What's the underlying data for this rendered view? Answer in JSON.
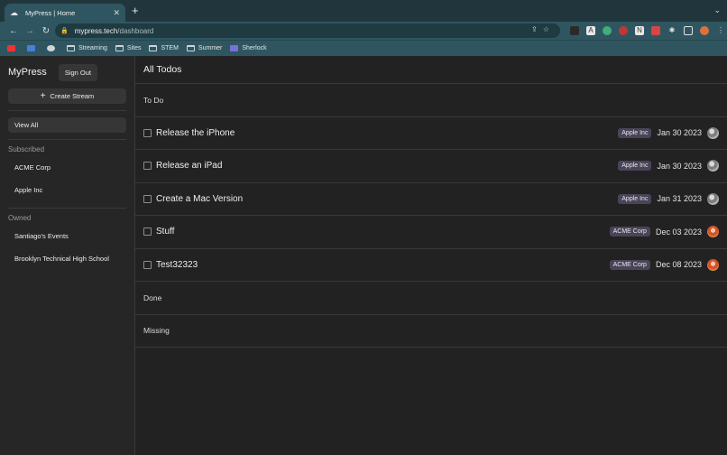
{
  "browser": {
    "tab_title": "MyPress | Home",
    "tab_close": "✕",
    "new_tab": "+",
    "url_host": "mypress.tech",
    "url_path": "/dashboard",
    "bookmarks": [
      {
        "label": "Streaming",
        "icon": "folder-icon"
      },
      {
        "label": "Sites",
        "icon": "folder-icon"
      },
      {
        "label": "STEM",
        "icon": "folder-icon"
      },
      {
        "label": "Summer",
        "icon": "folder-icon"
      },
      {
        "label": "Sherlock",
        "icon": "sherlock-bookmark-icon"
      }
    ]
  },
  "sidebar": {
    "brand": "MyPress",
    "sign_out": "Sign Out",
    "create_stream": "Create Stream",
    "view_all": "View All",
    "subscribed_label": "Subscribed",
    "subscribed": [
      "ACME Corp",
      "Apple Inc"
    ],
    "owned_label": "Owned",
    "owned": [
      "Santiago's Events",
      "Brooklyn Technical High School"
    ]
  },
  "main": {
    "title": "All Todos",
    "todo_label": "To Do",
    "done_label": "Done",
    "missing_label": "Missing",
    "todos": [
      {
        "title": "Release the iPhone",
        "stream": "Apple Inc",
        "date": "Jan 30 2023",
        "avatar": "gray"
      },
      {
        "title": "Release an iPad",
        "stream": "Apple Inc",
        "date": "Jan 30 2023",
        "avatar": "gray"
      },
      {
        "title": "Create a Mac Version",
        "stream": "Apple Inc",
        "date": "Jan 31 2023",
        "avatar": "gray"
      },
      {
        "title": "Stuff",
        "stream": "ACME Corp",
        "date": "Dec 03 2023",
        "avatar": "orange"
      },
      {
        "title": "Test32323",
        "stream": "ACME Corp",
        "date": "Dec 08 2023",
        "avatar": "orange"
      }
    ]
  },
  "colors": {
    "chrome_dark": "#21363c",
    "chrome": "#2f5660",
    "app_bg": "#222222",
    "sidebar_bg": "#262626",
    "badge_bg": "#4a4458"
  }
}
